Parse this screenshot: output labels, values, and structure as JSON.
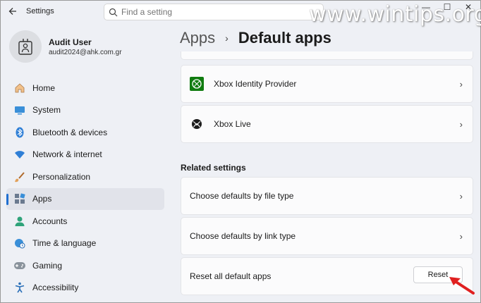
{
  "window": {
    "title": "Settings",
    "search_placeholder": "Find a setting",
    "watermark": "www.wintips.org"
  },
  "profile": {
    "name": "Audit User",
    "email": "audit2024@ahk.com.gr"
  },
  "sidebar": {
    "items": [
      {
        "label": "Home",
        "icon": "home-icon"
      },
      {
        "label": "System",
        "icon": "system-icon"
      },
      {
        "label": "Bluetooth & devices",
        "icon": "bluetooth-icon"
      },
      {
        "label": "Network & internet",
        "icon": "wifi-icon"
      },
      {
        "label": "Personalization",
        "icon": "brush-icon"
      },
      {
        "label": "Apps",
        "icon": "apps-icon",
        "active": true
      },
      {
        "label": "Accounts",
        "icon": "accounts-icon"
      },
      {
        "label": "Time & language",
        "icon": "globe-clock-icon"
      },
      {
        "label": "Gaming",
        "icon": "gamepad-icon"
      },
      {
        "label": "Accessibility",
        "icon": "accessibility-icon"
      }
    ]
  },
  "breadcrumb": {
    "parent": "Apps",
    "separator": "›",
    "current": "Default apps"
  },
  "apps_list": [
    {
      "label": "Xbox Identity Provider",
      "icon": "xbox-identity-icon"
    },
    {
      "label": "Xbox Live",
      "icon": "xbox-icon"
    }
  ],
  "related": {
    "title": "Related settings",
    "file_type": "Choose defaults by file type",
    "link_type": "Choose defaults by link type",
    "reset_label": "Reset all default apps",
    "reset_button": "Reset"
  },
  "colors": {
    "accent": "#1f6fd0",
    "annotation_arrow": "#e02020",
    "xbox_green": "#107c10"
  }
}
